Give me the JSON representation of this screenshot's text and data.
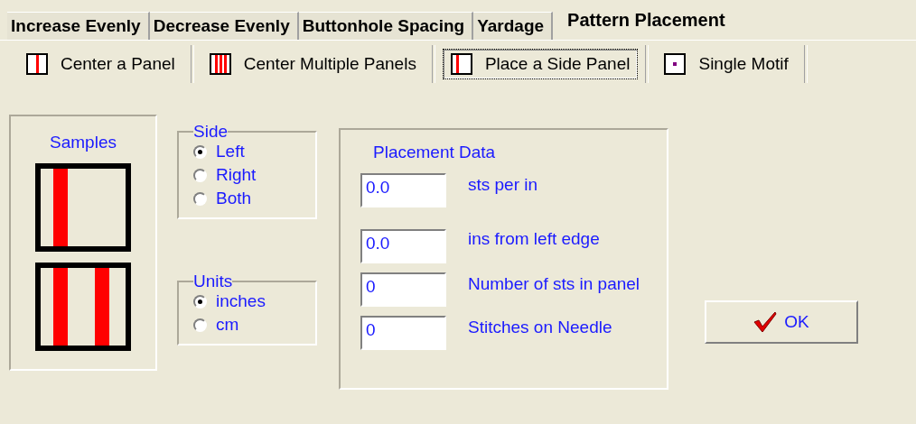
{
  "tabs": [
    {
      "label": "Increase Evenly",
      "selected": false
    },
    {
      "label": "Decrease Evenly",
      "selected": false
    },
    {
      "label": "Buttonhole Spacing",
      "selected": false
    },
    {
      "label": "Yardage",
      "selected": false
    },
    {
      "label": "Pattern Placement",
      "selected": true
    }
  ],
  "toolbar": [
    {
      "label": "Center a Panel",
      "kind": "center",
      "selected": false
    },
    {
      "label": "Center Multiple Panels",
      "kind": "multiple",
      "selected": false
    },
    {
      "label": "Place a Side Panel",
      "kind": "side",
      "selected": true
    },
    {
      "label": "Single Motif",
      "kind": "motif",
      "selected": false
    }
  ],
  "samples": {
    "title": "Samples",
    "items": [
      {
        "kind": "left"
      },
      {
        "kind": "both"
      }
    ]
  },
  "side": {
    "legend": "Side",
    "options": [
      {
        "label": "Left",
        "selected": true
      },
      {
        "label": "Right",
        "selected": false
      },
      {
        "label": "Both",
        "selected": false
      }
    ]
  },
  "units": {
    "legend": "Units",
    "options": [
      {
        "label": "inches",
        "selected": true
      },
      {
        "label": "cm",
        "selected": false
      }
    ]
  },
  "placement": {
    "title": "Placement Data",
    "fields": [
      {
        "value": "0.0",
        "label": "sts per in"
      },
      {
        "value": "0.0",
        "label": "ins from left edge"
      },
      {
        "value": "0",
        "label": "Number of sts in panel"
      },
      {
        "value": "0",
        "label": "Stitches on Needle"
      }
    ]
  },
  "ok_button": "OK"
}
